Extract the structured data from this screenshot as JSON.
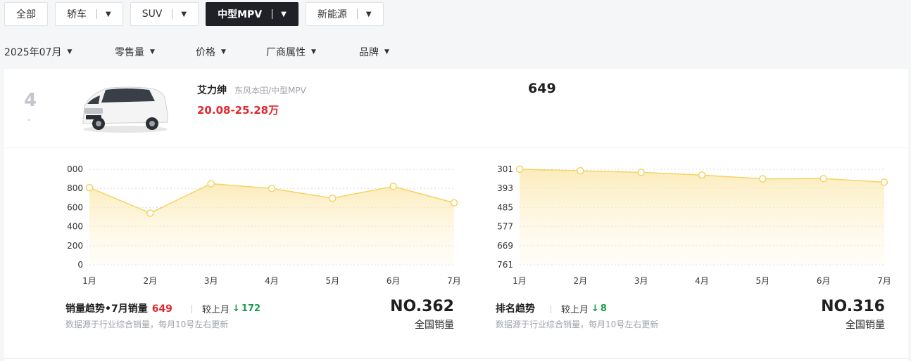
{
  "tabs": [
    {
      "label": "全部",
      "has_dropdown": false,
      "active": false
    },
    {
      "label": "轿车",
      "has_dropdown": true,
      "active": false
    },
    {
      "label": "SUV",
      "has_dropdown": true,
      "active": false
    },
    {
      "label": "中型MPV",
      "has_dropdown": true,
      "active": true
    },
    {
      "label": "新能源",
      "has_dropdown": true,
      "active": false
    }
  ],
  "filters": [
    {
      "label": "2025年07月"
    },
    {
      "label": "零售量"
    },
    {
      "label": "价格"
    },
    {
      "label": "厂商属性"
    },
    {
      "label": "品牌"
    }
  ],
  "car": {
    "rank": "4",
    "rank_change": "-",
    "name": "艾力绅",
    "maker": "东风本田/中型MPV",
    "price": "20.08-25.28万",
    "sales": "649"
  },
  "colors": {
    "accent_red": "#e0282e",
    "down_green": "#1a9b4b",
    "line_yellow": "#f5d361",
    "active_tab": "#1f2126"
  },
  "chart_data": [
    {
      "type": "area",
      "x": [
        "1月",
        "2月",
        "3月",
        "4月",
        "5月",
        "6月",
        "7月"
      ],
      "y_ticks": [
        "000",
        "800",
        "600",
        "400",
        "200",
        "0"
      ],
      "values": [
        808,
        541,
        849,
        799,
        697,
        821,
        649
      ],
      "ylim": [
        0,
        1000
      ],
      "grid": true
    },
    {
      "type": "area",
      "x": [
        "1月",
        "2月",
        "3月",
        "4月",
        "5月",
        "6月",
        "7月"
      ],
      "y_ticks": [
        "301",
        "393",
        "485",
        "577",
        "669",
        "761"
      ],
      "values": [
        301,
        308,
        316,
        329,
        347,
        346,
        363
      ],
      "ylim": [
        301,
        761
      ],
      "inverted": true,
      "grid": true
    }
  ],
  "sales_footer": {
    "title_prefix": "销量趋势•7月销量",
    "value": "649",
    "vs_label": "较上月",
    "arrow": "↓",
    "delta": "172",
    "source": "数据源于行业综合销量，每月10号左右更新",
    "rank": "NO.362",
    "rank_label": "全国销量"
  },
  "rank_footer": {
    "title": "排名趋势",
    "vs_label": "较上月",
    "arrow": "↓",
    "delta": "8",
    "source": "数据源于行业综合销量，每月10号左右更新",
    "rank": "NO.316",
    "rank_label": "全国销量"
  }
}
